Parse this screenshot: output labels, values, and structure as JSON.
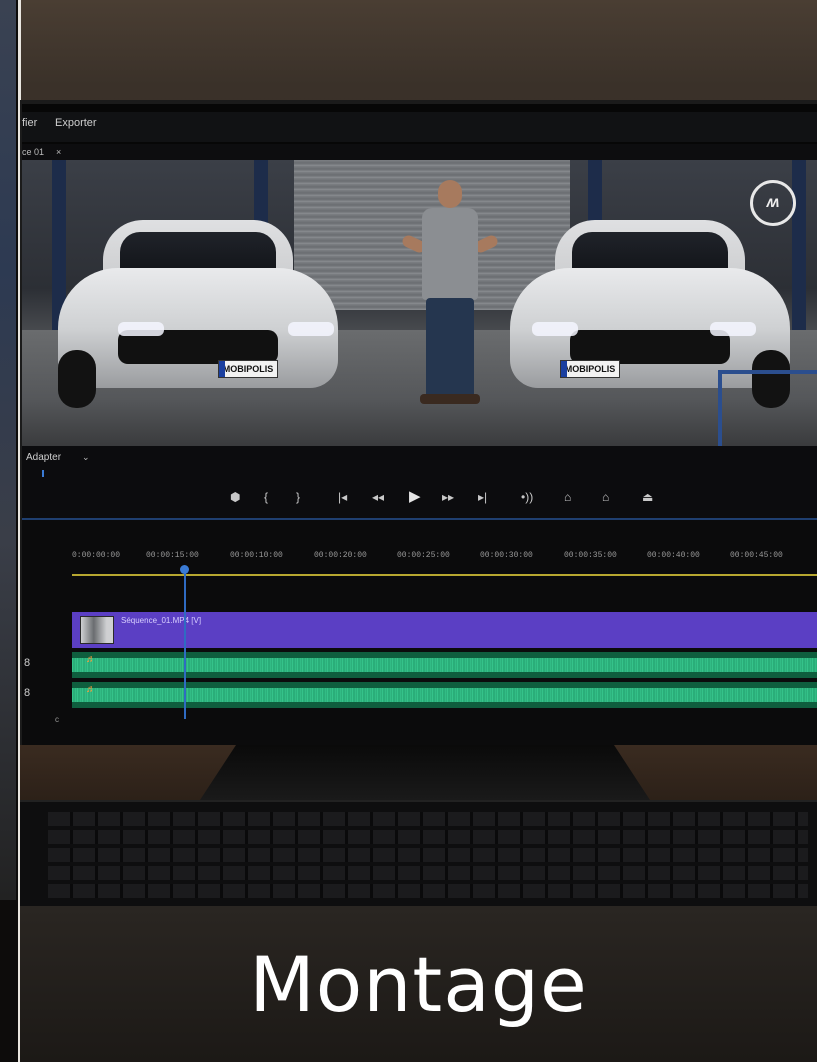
{
  "menu": {
    "item_1": "fier",
    "item_2": "Exporter"
  },
  "tab": {
    "label": "ce 01",
    "close": "×"
  },
  "preview": {
    "plate_left": "MOBIPOLIS",
    "plate_right": "MOBIPOLIS",
    "logo": "ʍ"
  },
  "viewer": {
    "fit_value": "Adapter",
    "fit_chevron": "⌄"
  },
  "transport": {
    "marker": "⬢",
    "mark_in": "{",
    "mark_out": "}",
    "go_in": "|◂",
    "step_back": "◂◂",
    "play": "▶",
    "step_fwd": "▸▸",
    "go_out": "▸|",
    "loop": "•))",
    "lift": "⌂",
    "extract": "⌂",
    "export": "⏏"
  },
  "timeline": {
    "timecodes": [
      "0:00:00:00",
      "00:00:15:00",
      "00:00:10:00",
      "00:00:20:00",
      "00:00:25:00",
      "00:00:30:00",
      "00:00:35:00",
      "00:00:40:00",
      "00:00:45:00"
    ],
    "video_clip_label": "Séquence_01.MP4 [V]",
    "audio_note": "♬",
    "track_link_icon": "8",
    "small_label": "c"
  },
  "title": "Montage"
}
